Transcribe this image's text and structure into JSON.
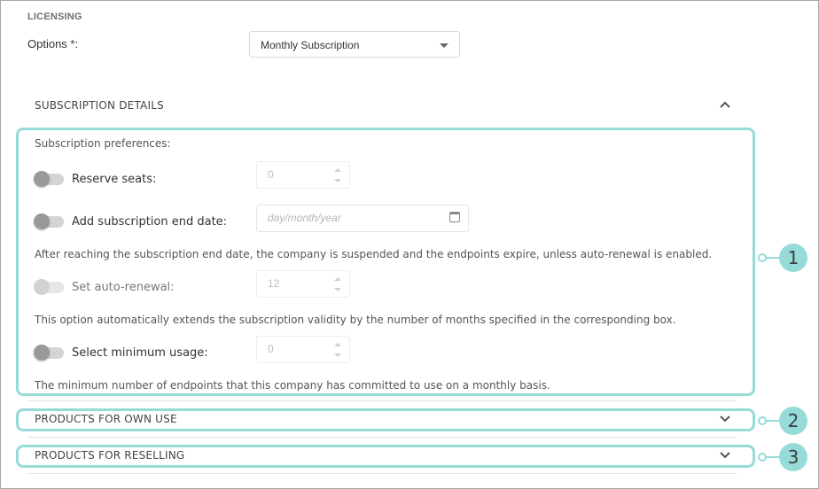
{
  "licensing": {
    "title": "LICENSING",
    "options_label": "Options *:",
    "options_value": "Monthly Subscription"
  },
  "subscription_details": {
    "header": "SUBSCRIPTION DETAILS",
    "expanded": true,
    "preferences_label": "Subscription preferences:",
    "reserve_seats": {
      "label": "Reserve seats:",
      "value": "0",
      "enabled": false
    },
    "end_date": {
      "label": "Add subscription end date:",
      "placeholder": "day/month/year",
      "enabled": false
    },
    "end_date_help": "After reaching the subscription end date, the company is suspended and the endpoints expire, unless auto-renewal is enabled.",
    "auto_renewal": {
      "label": "Set auto-renewal:",
      "value": "12",
      "enabled": false,
      "disabled": true
    },
    "auto_renewal_help": "This option automatically extends the subscription validity by the number of months specified in the corresponding box.",
    "minimum_usage": {
      "label": "Select minimum usage:",
      "value": "0",
      "enabled": false
    },
    "minimum_usage_help": "The minimum number of endpoints that this company has committed to use on a monthly basis."
  },
  "products_own_use": {
    "header": "PRODUCTS FOR OWN USE",
    "expanded": false
  },
  "products_reselling": {
    "header": "PRODUCTS FOR RESELLING",
    "expanded": false
  },
  "callouts": [
    "1",
    "2",
    "3"
  ],
  "colors": {
    "highlight": "#97dbd8"
  }
}
